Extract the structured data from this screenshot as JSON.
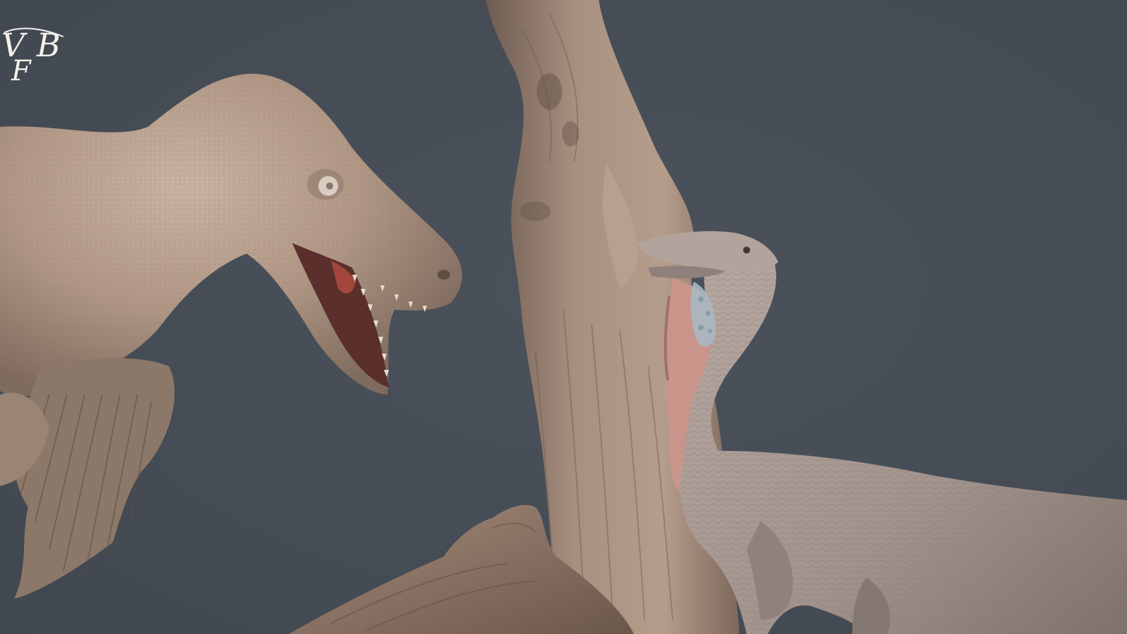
{
  "scene": {
    "subjects": [
      "raptor-left",
      "tree-stump",
      "feathered-dinosaur-right",
      "fallen-log"
    ],
    "colors": {
      "background": "#474e57",
      "raptor_skin": "#b79e8a",
      "raptor_skin_shadow": "#8c7565",
      "wood": "#a58d7c",
      "wood_shadow": "#6f5c52",
      "feathered_dino": "#a99b94",
      "prey_pink": "#c9958a",
      "prey_blue": "#a9b8c2"
    }
  },
  "watermark": {
    "letters": [
      "V",
      "F",
      "B"
    ],
    "color": "#f4f1ec"
  }
}
